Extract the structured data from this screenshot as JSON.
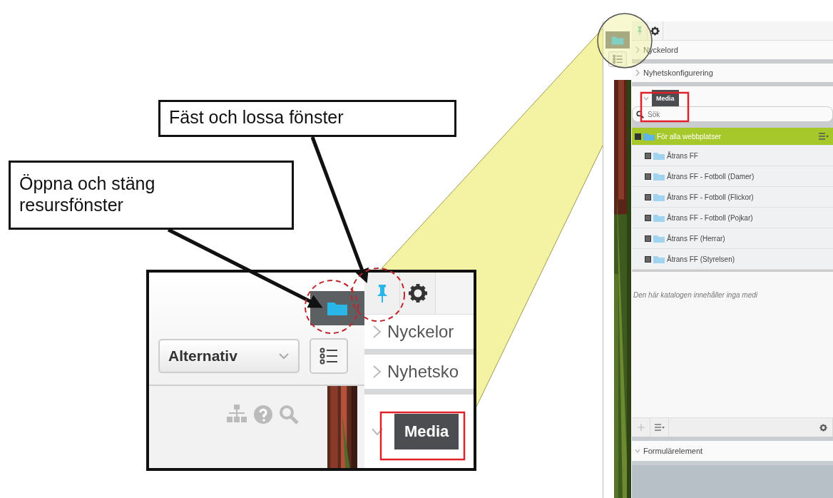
{
  "callouts": [
    {
      "text": "Fäst och lossa fönster"
    },
    {
      "text": "Öppna och stäng resursfönster"
    }
  ],
  "inset": {
    "panel_open": true,
    "pinned": true,
    "dropdown": "Alternativ",
    "sections": [
      {
        "label": "Nyckelor",
        "expanded": false
      },
      {
        "label": "Nyhetsko",
        "expanded": false
      },
      {
        "label": "Media",
        "expanded": true
      }
    ]
  },
  "panel": {
    "panel_open": true,
    "pinned": true,
    "search": {
      "placeholder": "Sök"
    },
    "sections": [
      {
        "label": "Nyckelord",
        "expanded": false
      },
      {
        "label": "Nyhetskonfigurering",
        "expanded": false
      },
      {
        "label": "Media",
        "expanded": true
      }
    ],
    "tree": {
      "label": "För alla webbplatser",
      "selected": true,
      "expanded": true,
      "children": [
        {
          "label": "Åtrans FF",
          "selected": false,
          "expanded": false
        },
        {
          "label": "Åtrans FF - Fotboll (Damer)",
          "selected": false,
          "expanded": false
        },
        {
          "label": "Åtrans FF - Fotboll (Flickor)",
          "selected": false,
          "expanded": false
        },
        {
          "label": "Åtrans FF - Fotboll (Pojkar)",
          "selected": false,
          "expanded": false
        },
        {
          "label": "Åtrans FF (Herrar)",
          "selected": false,
          "expanded": false
        },
        {
          "label": "Åtrans FF (Styrelsen)",
          "selected": false,
          "expanded": false
        }
      ]
    },
    "empty_message": "Den här katalogen innehåller inga medi",
    "bottom_section": {
      "label": "Formulärelement",
      "expanded": true
    }
  }
}
